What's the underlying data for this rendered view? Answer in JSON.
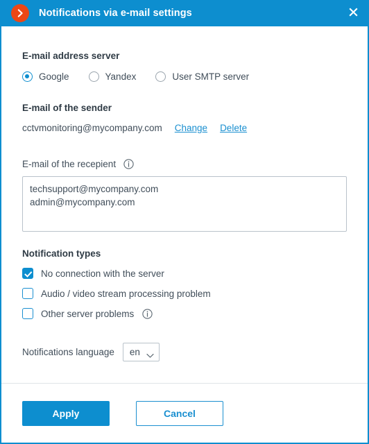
{
  "window": {
    "title": "Notifications via e-mail settings",
    "logo_icon": "chevron-right-circle-icon",
    "close_icon": "close-icon",
    "accent_color": "#0d8ecf",
    "logo_color": "#ec4715"
  },
  "server_section": {
    "title": "E-mail address server",
    "options": [
      {
        "label": "Google",
        "selected": true
      },
      {
        "label": "Yandex",
        "selected": false
      },
      {
        "label": "User SMTP server",
        "selected": false
      }
    ]
  },
  "sender_section": {
    "title": "E-mail of the sender",
    "email": "cctvmonitoring@mycompany.com",
    "change_label": "Change",
    "delete_label": "Delete"
  },
  "recipient_section": {
    "label": "E-mail of the recepient",
    "info_icon": "info-icon",
    "value": "techsupport@mycompany.com\nadmin@mycompany.com",
    "placeholder": ""
  },
  "notification_types": {
    "title": "Notification types",
    "items": [
      {
        "label": "No connection with the server",
        "checked": true,
        "info": false
      },
      {
        "label": "Audio / video stream processing problem",
        "checked": false,
        "info": false
      },
      {
        "label": "Other server problems",
        "checked": false,
        "info": true
      }
    ]
  },
  "language_section": {
    "label": "Notifications language",
    "value": "en",
    "chevron_icon": "chevron-down-icon",
    "options": [
      "en"
    ]
  },
  "footer": {
    "apply_label": "Apply",
    "cancel_label": "Cancel"
  }
}
